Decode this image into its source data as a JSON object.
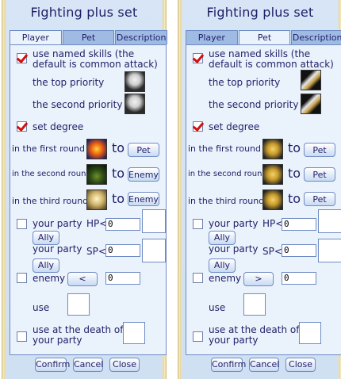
{
  "colors": {
    "accent_red": "#d01010",
    "panel_bg": "#eaf2fc",
    "border": "#6f8bc4",
    "title": "#1f1f66"
  },
  "windows": [
    {
      "title": "Fighting plus set",
      "tabs": [
        {
          "label": "Player",
          "active": true
        },
        {
          "label": "Pet",
          "active": false
        },
        {
          "label": "Description",
          "active": false
        }
      ],
      "named_skills": {
        "checked": true,
        "label": "use named skills (the default is common attack)",
        "top_priority_label": "the top priority",
        "top_priority_icon": "ghost-skill-icon",
        "second_priority_label": "the second priority",
        "second_priority_icon": "ghost-skill-icon"
      },
      "set_degree": {
        "checked": true,
        "label": "set degree"
      },
      "rounds": [
        {
          "label": "in the first round",
          "icon": "mask-skill-icon",
          "to": "to",
          "target": "Pet"
        },
        {
          "label": "in the second round",
          "icon": "tree-skill-icon",
          "to": "to",
          "target": "Enemy"
        },
        {
          "label": "in the third round",
          "icon": "angel-skill-icon",
          "to": "to",
          "target": "Enemy"
        }
      ],
      "party": {
        "checked": false,
        "label": "your party",
        "hp_label": "HP<",
        "hp_value": "0",
        "ally_label": "Ally",
        "sp_label": "SP<",
        "sp_value": "0",
        "ally2_label": "Ally",
        "second_line": "your party"
      },
      "enemy": {
        "checked": false,
        "label": "enemy",
        "op": "<",
        "value": "0"
      },
      "use": {
        "label": "use"
      },
      "death": {
        "checked": false,
        "label": "use at the death of your party"
      },
      "buttons": {
        "confirm": "Confirm",
        "cancel": "Cancel",
        "close": "Close"
      }
    },
    {
      "title": "Fighting plus set",
      "tabs": [
        {
          "label": "Player",
          "active": false
        },
        {
          "label": "Pet",
          "active": true
        },
        {
          "label": "Description",
          "active": false
        }
      ],
      "named_skills": {
        "checked": true,
        "label": "use named skills (the default is common attack)",
        "top_priority_label": "the top priority",
        "top_priority_icon": "sword-skill-icon",
        "second_priority_label": "the second priority",
        "second_priority_icon": "sword-skill-icon"
      },
      "set_degree": {
        "checked": true,
        "label": "set degree"
      },
      "rounds": [
        {
          "label": "in the first round",
          "icon": "shield-skill-icon",
          "to": "to",
          "target": "Pet"
        },
        {
          "label": "in the second round",
          "icon": "shield-skill-icon",
          "to": "to",
          "target": "Pet"
        },
        {
          "label": "in the third round",
          "icon": "shield-skill-icon",
          "to": "to",
          "target": "Pet"
        }
      ],
      "party": {
        "checked": false,
        "label": "your party",
        "hp_label": "HP<",
        "hp_value": "0",
        "ally_label": "Ally",
        "sp_label": "SP<",
        "sp_value": "0",
        "ally2_label": "Ally",
        "second_line": "your party"
      },
      "enemy": {
        "checked": false,
        "label": "enemy",
        "op": ">",
        "value": "0"
      },
      "use": {
        "label": "use"
      },
      "death": {
        "checked": false,
        "label": "use at the death of your party"
      },
      "buttons": {
        "confirm": "Confirm",
        "cancel": "Cancel",
        "close": "Close"
      }
    }
  ]
}
